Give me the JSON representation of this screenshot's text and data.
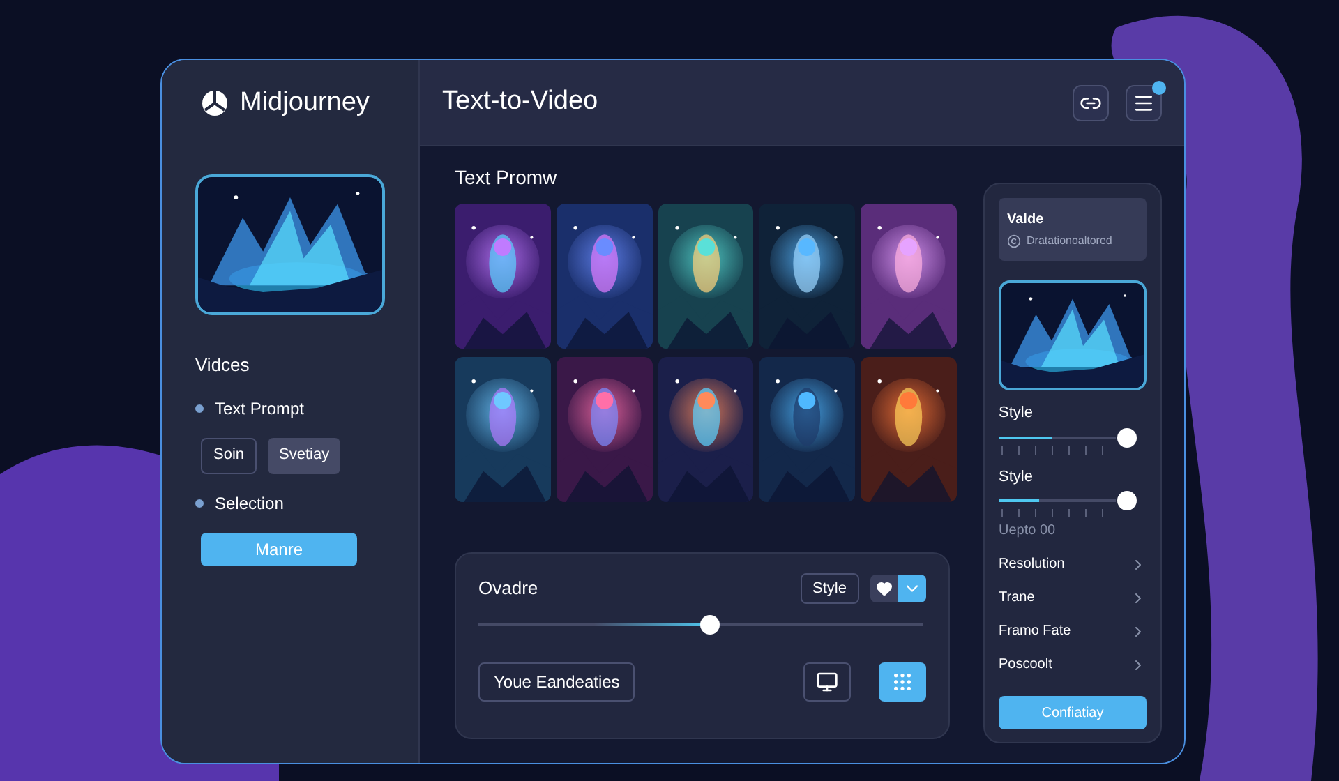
{
  "brand": {
    "name": "Midjourney"
  },
  "header": {
    "title": "Text-to-Video",
    "actions": [
      {
        "kind": "link",
        "badge": false
      },
      {
        "kind": "menu",
        "badge": true
      }
    ]
  },
  "sidebar": {
    "heading": "Vidces",
    "sections": [
      {
        "label": "Text Prompt",
        "buttons": [
          {
            "label": "Soin",
            "selected": false
          },
          {
            "label": "Svetiay",
            "selected": true
          }
        ]
      },
      {
        "label": "Selection",
        "buttons": [
          {
            "label": "Manre",
            "selected": true
          }
        ]
      }
    ]
  },
  "main": {
    "heading": "Text Promw",
    "controls": {
      "label": "Ovadre",
      "style_button": "Style",
      "toggle": [
        {
          "kind": "heart",
          "selected": false
        },
        {
          "kind": "chevron",
          "selected": true
        }
      ],
      "slider": {
        "level": 0.52
      },
      "action": "Youe Eandeaties",
      "view_buttons": [
        {
          "kind": "monitor",
          "selected": false
        },
        {
          "kind": "grid",
          "selected": true
        }
      ]
    }
  },
  "panel": {
    "card": {
      "title": "Valde",
      "subtitle": "Dratationoaltored"
    },
    "sliders": [
      {
        "label": "Style",
        "level": 0.45
      },
      {
        "label": "Style",
        "level": 0.35
      }
    ],
    "note": "Uepto 00",
    "menu": [
      "Resolution",
      "Trane",
      "Framo Fate",
      "Poscoolt"
    ],
    "button": "Confiatiay"
  }
}
